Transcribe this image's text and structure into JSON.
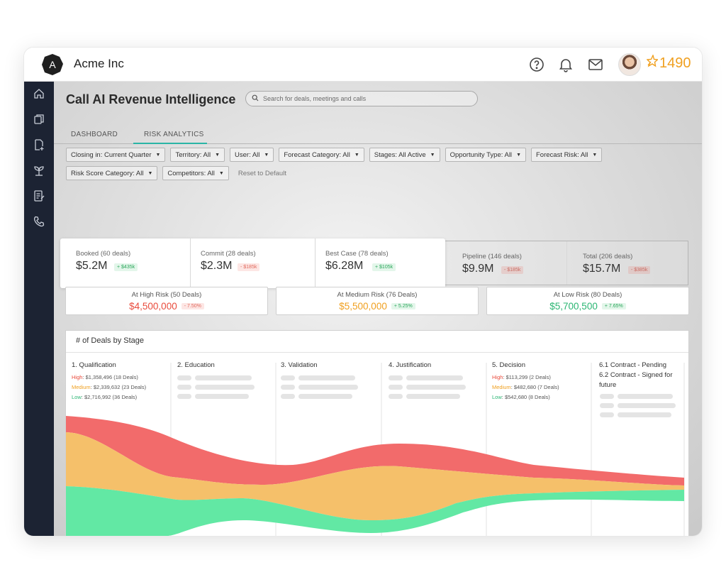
{
  "app": {
    "logo_letter": "A",
    "company": "Acme Inc",
    "score": "1490",
    "icons": [
      "help-icon",
      "bell-icon",
      "mail-icon"
    ]
  },
  "sidebar": {
    "icons": [
      "home-icon",
      "copy-icon",
      "document-icon",
      "plant-icon",
      "notes-icon",
      "phone-icon"
    ]
  },
  "page": {
    "title": "Call AI Revenue Intelligence",
    "search_placeholder": "Search for deals, meetings and calls",
    "tabs": [
      {
        "label": "DASHBOARD"
      },
      {
        "label": "RISK ANALYTICS",
        "active": true
      }
    ]
  },
  "filters": {
    "row1": [
      "Closing in: Current Quarter",
      "Territory: All",
      "User: All",
      "Forecast Category: All",
      "Stages: All Active",
      "Opportunity Type: All",
      "Forecast Risk: All"
    ],
    "row2": [
      "Risk Score Category: All",
      "Competitors: All"
    ],
    "reset_label": "Reset to Default"
  },
  "stats": [
    {
      "label": "Booked (60 deals)",
      "value": "$5.2M",
      "delta": "+ $435k",
      "trend": "up"
    },
    {
      "label": "Commit (28 deals)",
      "value": "$2.3M",
      "delta": "- $185k",
      "trend": "down"
    },
    {
      "label": "Best Case (78 deals)",
      "value": "$6.28M",
      "delta": "+ $105k",
      "trend": "up"
    },
    {
      "label": "Pipeline (146 deals)",
      "value": "$9.9M",
      "delta": "- $185k",
      "trend": "down"
    },
    {
      "label": "Total (206 deals)",
      "value": "$15.7M",
      "delta": "- $385k",
      "trend": "down"
    }
  ],
  "risk": [
    {
      "label": "At High Risk (50 Deals)",
      "value": "$4,500,000",
      "delta": "- 7.50%",
      "color": "#e94b3c",
      "delta_bg": "#fde6e4",
      "delta_color": "#e06a5e"
    },
    {
      "label": "At Medium Risk (76 Deals)",
      "value": "$5,500,000",
      "delta": "+ 5.25%",
      "color": "#f0a020",
      "delta_bg": "#e3f6ea",
      "delta_color": "#2aa65a"
    },
    {
      "label": "At Low Risk (80 Deals)",
      "value": "$5,700,500",
      "delta": "+ 7.65%",
      "color": "#2bb673",
      "delta_bg": "#e3f6ea",
      "delta_color": "#2aa65a"
    }
  ],
  "chart": {
    "title": "# of Deals by Stage",
    "stages": [
      {
        "name": "1. Qualification",
        "lines": [
          {
            "key": "High",
            "text": "$1,358,496 (18 Deals)"
          },
          {
            "key": "Medium",
            "text": "$2,339,632 (23 Deals)"
          },
          {
            "key": "Low",
            "text": "$2,716,992 (36 Deals)"
          }
        ]
      },
      {
        "name": "2. Education",
        "lines": []
      },
      {
        "name": "3. Validation",
        "lines": []
      },
      {
        "name": "4. Justification",
        "lines": []
      },
      {
        "name": "5. Decision",
        "lines": [
          {
            "key": "High",
            "text": "$113,299 (2 Deals)"
          },
          {
            "key": "Medium",
            "text": "$482,680 (7 Deals)"
          },
          {
            "key": "Low",
            "text": "$542,680 (8 Deals)"
          }
        ]
      },
      {
        "name_lines": [
          "6.1 Contract - Pending",
          "6.2 Contract - Signed for",
          "future"
        ],
        "lines": []
      }
    ],
    "colors": {
      "high": "#f26b6b",
      "medium": "#f5c06a",
      "low": "#62e8a4"
    }
  },
  "chart_data": {
    "type": "area",
    "title": "# of Deals by Stage",
    "categories": [
      "1. Qualification",
      "2. Education",
      "3. Validation",
      "4. Justification",
      "5. Decision",
      "6.1 Contract - Pending / 6.2 Contract - Signed for future"
    ],
    "series": [
      {
        "name": "High",
        "values": [
          18,
          null,
          null,
          null,
          2,
          null
        ],
        "amounts": [
          "$1,358,496",
          null,
          null,
          null,
          "$113,299",
          null
        ]
      },
      {
        "name": "Medium",
        "values": [
          23,
          null,
          null,
          null,
          7,
          null
        ],
        "amounts": [
          "$2,339,632",
          null,
          null,
          null,
          "$482,680",
          null
        ]
      },
      {
        "name": "Low",
        "values": [
          36,
          null,
          null,
          null,
          8,
          null
        ],
        "amounts": [
          "$2,716,992",
          null,
          null,
          null,
          "$542,680",
          null
        ]
      }
    ]
  }
}
